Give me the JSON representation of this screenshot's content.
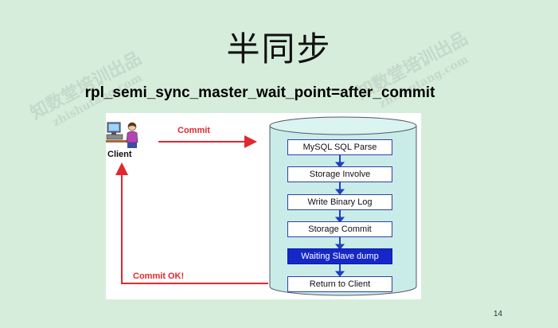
{
  "slide": {
    "title": "半同步",
    "subtitle": "rpl_semi_sync_master_wait_point=after_commit",
    "page_number": "14",
    "watermark_text": "知数堂培训出品",
    "watermark_url": "zhishutang.com"
  },
  "diagram": {
    "client_label": "Client",
    "commit_label": "Commit",
    "commit_ok_label": "Commit OK!",
    "steps": [
      {
        "label": "MySQL SQL Parse",
        "highlight": false
      },
      {
        "label": "Storage Involve",
        "highlight": false
      },
      {
        "label": "Write Binary Log",
        "highlight": false
      },
      {
        "label": "Storage Commit",
        "highlight": false
      },
      {
        "label": "Waiting Slave dump",
        "highlight": true
      },
      {
        "label": "Return to Client",
        "highlight": false
      }
    ],
    "colors": {
      "arrow": "#e0282e",
      "step_arrow": "#1f3fc0",
      "highlight_box": "#1627c9",
      "cylinder": "#c9ece9"
    }
  }
}
